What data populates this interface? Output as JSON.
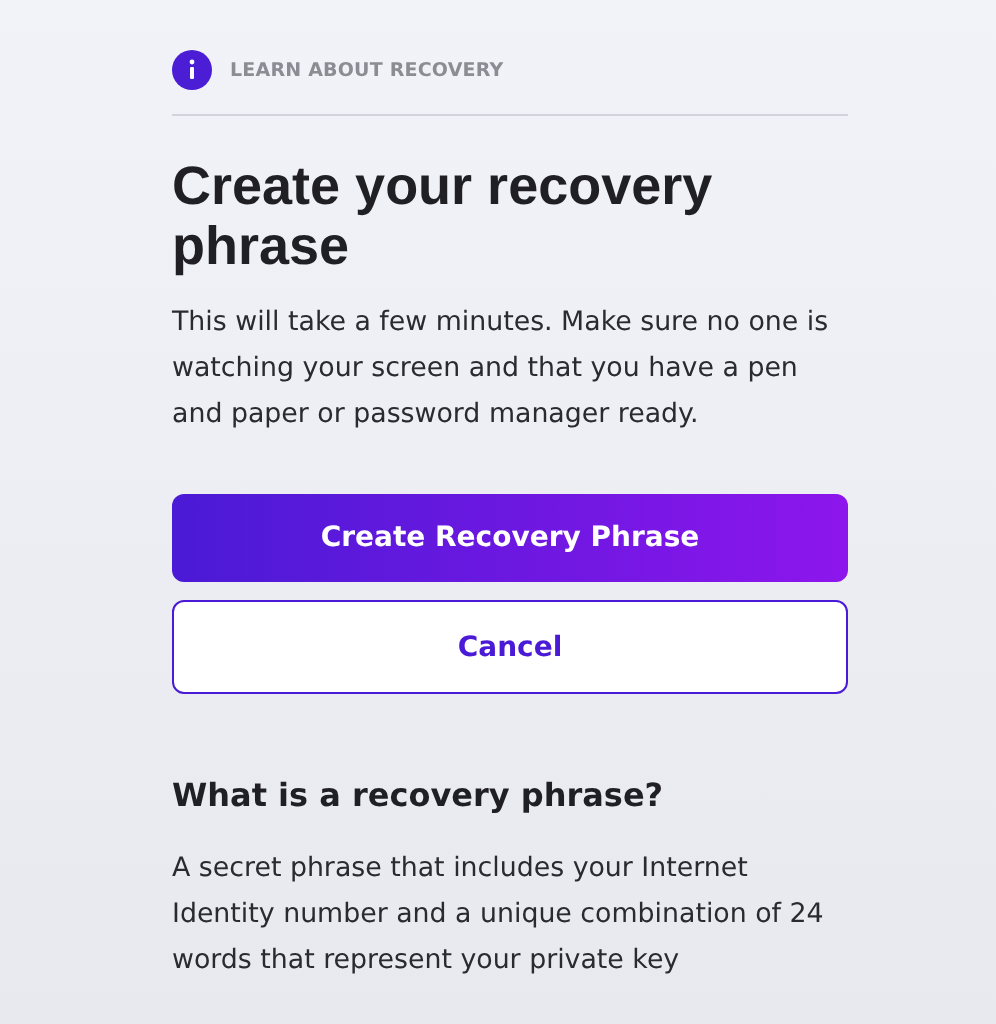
{
  "info_link": {
    "label": "LEARN ABOUT RECOVERY"
  },
  "title": "Create your recovery phrase",
  "intro": "This will take a few minutes. Make sure no one is watching your screen and that you have a pen and paper or password manager ready.",
  "buttons": [
    {
      "label": "Create Recovery Phrase",
      "kind": "primary"
    },
    {
      "label": "Cancel",
      "kind": "secondary"
    }
  ],
  "section": {
    "heading": "What is a recovery phrase?",
    "text": "A secret phrase that includes your Internet Identity number and a unique combination of 24 words that represent your private key"
  }
}
